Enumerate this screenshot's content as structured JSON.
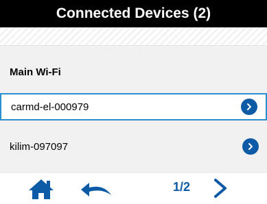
{
  "header": {
    "title": "Connected Devices (2)"
  },
  "section": {
    "title": "Main Wi-Fi"
  },
  "devices": [
    {
      "label": "carmd-el-000979",
      "selected": true
    },
    {
      "label": "kilim-097097",
      "selected": false
    }
  ],
  "pagination": {
    "indicator": "1/2"
  },
  "icons": {
    "home": "home-icon",
    "back": "back-arrow-icon",
    "next": "chevron-right-icon",
    "row_chevron": "chevron-right-circle-icon"
  },
  "colors": {
    "accent": "#0d5aa6",
    "selected_border": "#2a8fd0",
    "header_bg": "#000000"
  }
}
